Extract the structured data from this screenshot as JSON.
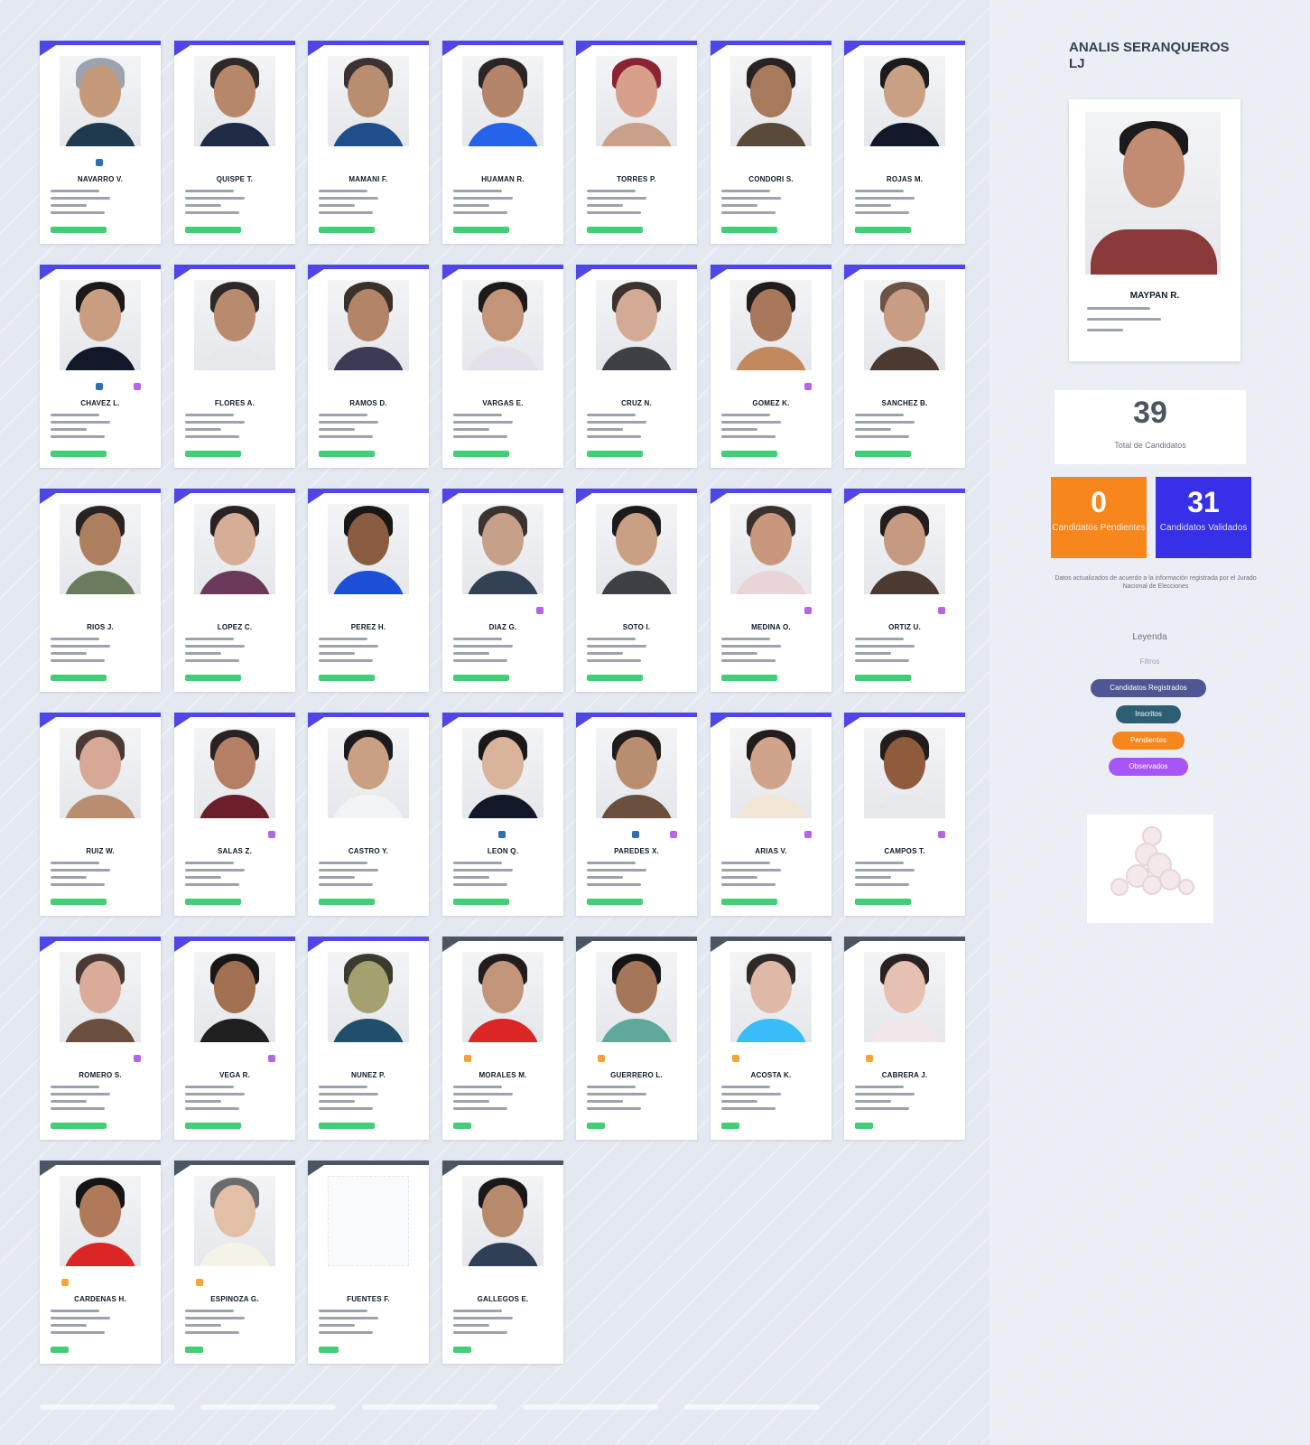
{
  "grid": {
    "cards": [
      {
        "name": "NAVARRO V.",
        "skin": "#c49a7a",
        "hair": "#9ca3af",
        "shirt": "#1f3a4f",
        "status": "active",
        "dots": [
          "blue"
        ]
      },
      {
        "name": "QUISPE T.",
        "skin": "#b7876a",
        "hair": "#2f2a28",
        "shirt": "#1f2a44",
        "status": "active",
        "dots": []
      },
      {
        "name": "MAMANI F.",
        "skin": "#b98d70",
        "hair": "#3b3330",
        "shirt": "#1f4f8a",
        "status": "active",
        "dots": []
      },
      {
        "name": "HUAMAN R.",
        "skin": "#b4846a",
        "hair": "#2b2523",
        "shirt": "#2563eb",
        "status": "active",
        "dots": []
      },
      {
        "name": "TORRES P.",
        "skin": "#d8a08a",
        "hair": "#8b2332",
        "shirt": "#c9a089",
        "status": "active",
        "dots": []
      },
      {
        "name": "CONDORI S.",
        "skin": "#a77a5b",
        "hair": "#2a2220",
        "shirt": "#5a4a3a",
        "status": "active",
        "dots": []
      },
      {
        "name": "ROJAS M.",
        "skin": "#caa084",
        "hair": "#1c1a1a",
        "shirt": "#111827",
        "status": "active",
        "dots": []
      },
      {
        "name": "CHAVEZ L.",
        "skin": "#c99e80",
        "hair": "#1a1818",
        "shirt": "#111827",
        "status": "active",
        "dots": [
          "blue",
          "purple"
        ]
      },
      {
        "name": "FLORES A.",
        "skin": "#b88b6f",
        "hair": "#2f2a28",
        "shirt": "#e5e7eb",
        "status": "active",
        "dots": []
      },
      {
        "name": "RAMOS D.",
        "skin": "#b48468",
        "hair": "#3a302c",
        "shirt": "#3d3a55",
        "status": "active",
        "dots": []
      },
      {
        "name": "VARGAS E.",
        "skin": "#c39478",
        "hair": "#1e1a19",
        "shirt": "#e6e0ea",
        "status": "active",
        "dots": []
      },
      {
        "name": "CRUZ N.",
        "skin": "#d3ab94",
        "hair": "#3b3330",
        "shirt": "#3f3f46",
        "status": "active",
        "dots": []
      },
      {
        "name": "GOMEZ K.",
        "skin": "#a9785a",
        "hair": "#221c1a",
        "shirt": "#c2895f",
        "status": "active",
        "dots": [
          "purple"
        ]
      },
      {
        "name": "SANCHEZ B.",
        "skin": "#c89d83",
        "hair": "#6b5446",
        "shirt": "#4b3a30",
        "status": "active",
        "dots": []
      },
      {
        "name": "RIOS J.",
        "skin": "#ae7f5e",
        "hair": "#2a2220",
        "shirt": "#6b7b5e",
        "status": "active",
        "dots": []
      },
      {
        "name": "LOPEZ C.",
        "skin": "#d6ad96",
        "hair": "#2a2220",
        "shirt": "#6b3a5a",
        "status": "active",
        "dots": []
      },
      {
        "name": "PEREZ H.",
        "skin": "#8a5d42",
        "hair": "#1a1616",
        "shirt": "#1d4ed8",
        "status": "active",
        "dots": []
      },
      {
        "name": "DIAZ G.",
        "skin": "#c7a08a",
        "hair": "#3b3330",
        "shirt": "#334155",
        "status": "active",
        "dots": [
          "purple"
        ]
      },
      {
        "name": "SOTO I.",
        "skin": "#caa084",
        "hair": "#1c1a1a",
        "shirt": "#3f3f46",
        "status": "active",
        "dots": []
      },
      {
        "name": "MEDINA O.",
        "skin": "#c8977e",
        "hair": "#3a302c",
        "shirt": "#e9d5d8",
        "status": "active",
        "dots": [
          "purple"
        ]
      },
      {
        "name": "ORTIZ U.",
        "skin": "#c59a80",
        "hair": "#221c1a",
        "shirt": "#4b3a30",
        "status": "active",
        "dots": [
          "purple"
        ]
      },
      {
        "name": "RUIZ W.",
        "skin": "#d7a896",
        "hair": "#4a3a34",
        "shirt": "#b98d70",
        "status": "active",
        "dots": []
      },
      {
        "name": "SALAS Z.",
        "skin": "#b47f65",
        "hair": "#2a2220",
        "shirt": "#6b1f2a",
        "status": "active",
        "dots": [
          "purple"
        ]
      },
      {
        "name": "CASTRO Y.",
        "skin": "#caa084",
        "hair": "#1c1a1a",
        "shirt": "#f3f4f6",
        "status": "active",
        "dots": []
      },
      {
        "name": "LEON Q.",
        "skin": "#d9b49a",
        "hair": "#1a1818",
        "shirt": "#111827",
        "status": "active",
        "dots": [
          "blue"
        ]
      },
      {
        "name": "PAREDES X.",
        "skin": "#b98d70",
        "hair": "#221c1a",
        "shirt": "#6b4f3e",
        "status": "active",
        "dots": [
          "blue",
          "purple"
        ]
      },
      {
        "name": "ARIAS V.",
        "skin": "#d0a48a",
        "hair": "#221c1a",
        "shirt": "#f1e6d6",
        "status": "active",
        "dots": [
          "purple"
        ]
      },
      {
        "name": "CAMPOS T.",
        "skin": "#8f5b3d",
        "hair": "#221c1a",
        "shirt": "#e5e7eb",
        "status": "active",
        "dots": [
          "purple"
        ]
      },
      {
        "name": "ROMERO S.",
        "skin": "#d9ab98",
        "hair": "#4a3a34",
        "shirt": "#6b4f3e",
        "status": "active",
        "dots": [
          "purple"
        ]
      },
      {
        "name": "VEGA R.",
        "skin": "#a07050",
        "hair": "#1a1616",
        "shirt": "#1f1f1f",
        "status": "active",
        "dots": [
          "purple"
        ]
      },
      {
        "name": "NUNEZ P.",
        "skin": "#a5a070",
        "hair": "#3b3a2c",
        "shirt": "#1f4f6a",
        "status": "active",
        "dots": []
      },
      {
        "name": "MORALES M.",
        "skin": "#c2957a",
        "hair": "#221c1a",
        "shirt": "#dc2626",
        "status": "pending",
        "dots": [
          "orange"
        ]
      },
      {
        "name": "GUERRERO L.",
        "skin": "#a5775a",
        "hair": "#161414",
        "shirt": "#5fa89a",
        "status": "pending",
        "dots": [
          "orange"
        ]
      },
      {
        "name": "ACOSTA K.",
        "skin": "#e0b8a8",
        "hair": "#2f2a28",
        "shirt": "#38bdf8",
        "status": "pending",
        "dots": [
          "orange"
        ]
      },
      {
        "name": "CABRERA J.",
        "skin": "#e6c0b0",
        "hair": "#2a2220",
        "shirt": "#f1e6ea",
        "status": "pending",
        "dots": [
          "orange"
        ]
      },
      {
        "name": "CARDENAS H.",
        "skin": "#b07a5a",
        "hair": "#161414",
        "shirt": "#dc2626",
        "status": "pending",
        "dots": [
          "orange"
        ]
      },
      {
        "name": "ESPINOZA G.",
        "skin": "#e2c0a8",
        "hair": "#6b6b6b",
        "shirt": "#f5f3e7",
        "status": "pending",
        "dots": [
          "orange"
        ]
      },
      {
        "name": "FUENTES F.",
        "skin": "",
        "hair": "",
        "shirt": "",
        "status": "pending",
        "dots": []
      },
      {
        "name": "GALLEGOS E.",
        "skin": "#b88a6c",
        "hair": "#1a1818",
        "shirt": "#2f3f55",
        "status": "pending",
        "dots": []
      }
    ]
  },
  "panel": {
    "title": "ANALIS SERANQUEROS LJ",
    "featured": {
      "name": "MAYPAN R.",
      "skin": "#c28c72",
      "hair": "#1c1a1a",
      "shirt": "#8b3a3a"
    },
    "total_count": "39",
    "total_label": "Total de Candidatos",
    "stats": [
      {
        "value": "0",
        "label": "Candidatos Pendientes",
        "color": "#f7861d"
      },
      {
        "value": "31",
        "label": "Candidatos Validados",
        "color": "#3730e8"
      }
    ],
    "note": "Datos actualizados de acuerdo a la información registrada por el Jurado Nacional de Elecciones",
    "legend_title": "Leyenda",
    "legend_sub": "Filtros",
    "pills": [
      {
        "label": "Candidatos Registrados",
        "color": "#4e5694"
      },
      {
        "label": "Inscritos",
        "color": "#2c5f73"
      },
      {
        "label": "Pendientes",
        "color": "#f7861d"
      },
      {
        "label": "Observados",
        "color": "#a855f7"
      }
    ]
  },
  "colors": {
    "accent": "#4f46e5",
    "pending_border": "#4b5563",
    "success": "#22c55e",
    "dot_blue": "#2f6db4",
    "dot_purple": "#b566e6",
    "dot_orange": "#f7a33b"
  }
}
